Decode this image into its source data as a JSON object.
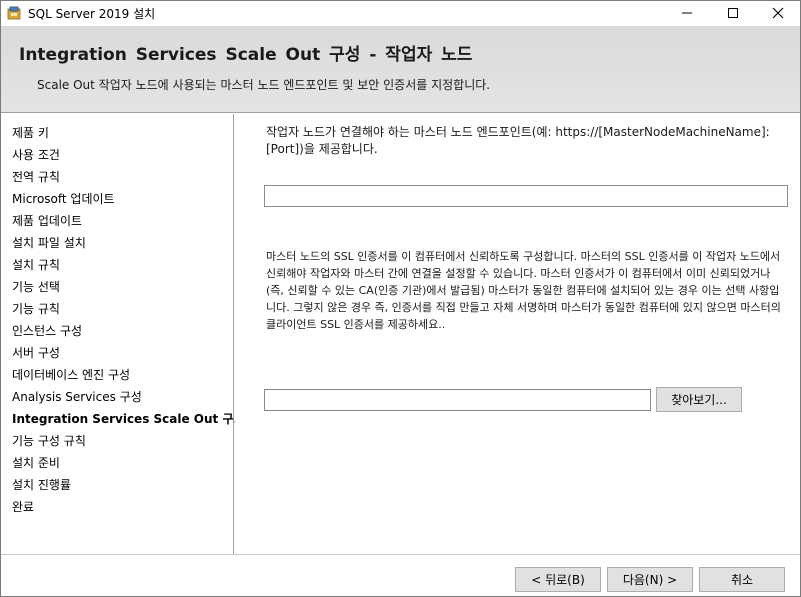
{
  "window": {
    "title": "SQL Server 2019 설치",
    "minimize_glyph": "—",
    "maximize_glyph": "☐",
    "close_glyph": "✕"
  },
  "header": {
    "title": "Integration Services Scale Out 구성 - 작업자 노드",
    "subtitle": "Scale Out 작업자 노드에 사용되는 마스터 노드 엔드포인트 및 보안 인증서를 지정합니다."
  },
  "sidebar": {
    "items": [
      {
        "label": "제품 키"
      },
      {
        "label": "사용 조건"
      },
      {
        "label": "전역 규칙"
      },
      {
        "label": "Microsoft 업데이트"
      },
      {
        "label": "제품 업데이트"
      },
      {
        "label": "설치 파일 설치"
      },
      {
        "label": "설치 규칙"
      },
      {
        "label": "기능 선택"
      },
      {
        "label": "기능 규칙"
      },
      {
        "label": "인스턴스 구성"
      },
      {
        "label": "서버 구성"
      },
      {
        "label": "데이터베이스 엔진 구성"
      },
      {
        "label": "Analysis Services 구성"
      },
      {
        "label": "Integration Services Scale Out 구..."
      },
      {
        "label": "기능 구성 규칙"
      },
      {
        "label": "설치 준비"
      },
      {
        "label": "설치 진행률"
      },
      {
        "label": "완료"
      }
    ],
    "active_index": 13
  },
  "main": {
    "endpoint_description": "작업자 노드가 연결해야 하는 마스터 노드 엔드포인트(예: https://[MasterNodeMachineName]:[Port])을 제공합니다.",
    "endpoint_value": "",
    "certificate_description": "마스터 노드의 SSL 인증서를 이 컴퓨터에서 신뢰하도록 구성합니다. 마스터의 SSL 인증서를 이 작업자 노드에서 신뢰해야 작업자와 마스터 간에 연결을 설정할 수 있습니다. 마스터 인증서가 이 컴퓨터에서 이미 신뢰되었거나(즉, 신뢰할 수 있는 CA(인증 기관)에서 발급됨) 마스터가 동일한 컴퓨터에 설치되어 있는 경우 이는 선택 사항입니다. 그렇지 않은 경우 즉, 인증서를 직접 만들고 자체 서명하며 마스터가 동일한 컴퓨터에 있지 않으면 마스터의 클라이언트 SSL 인증서를 제공하세요..",
    "certificate_value": "",
    "browse_label": "찾아보기..."
  },
  "footer": {
    "back_label": "< 뒤로(B)",
    "next_label": "다음(N) >",
    "cancel_label": "취소"
  }
}
